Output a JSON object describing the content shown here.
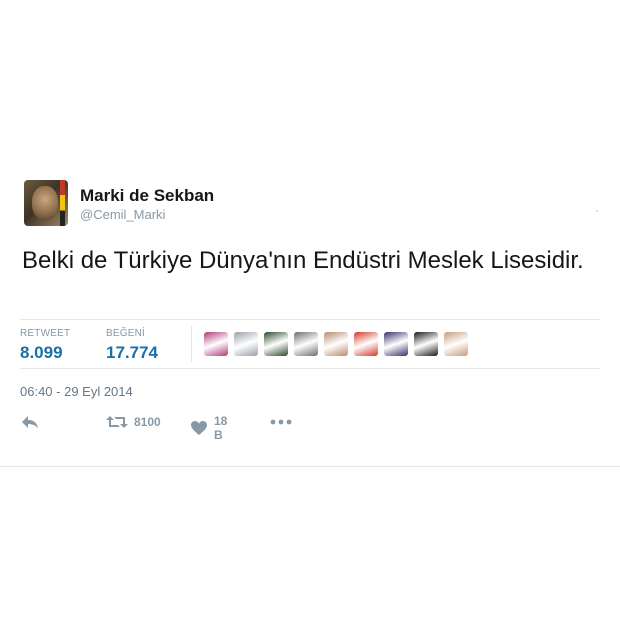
{
  "user": {
    "name": "Marki de Sekban",
    "handle": "@Cemil_Marki"
  },
  "tweet": {
    "text": "Belki de Türkiye Dünya'nın Endüstri Meslek Lisesidir.",
    "timestamp": "06:40 - 29 Eyl 2014"
  },
  "stats": {
    "retweet_label": "RETWEET",
    "retweet_value": "8.099",
    "like_label": "BEĞENİ",
    "like_value": "17.774"
  },
  "likers": [
    {
      "icon": "liker-avatar-1",
      "color": "#b03a7a"
    },
    {
      "icon": "liker-avatar-2",
      "color": "#9aa0a8"
    },
    {
      "icon": "liker-avatar-3",
      "color": "#2e4a2e"
    },
    {
      "icon": "liker-avatar-4",
      "color": "#6d6d6d"
    },
    {
      "icon": "liker-avatar-5",
      "color": "#b88a70"
    },
    {
      "icon": "liker-avatar-6",
      "color": "#d43a2a"
    },
    {
      "icon": "liker-avatar-7",
      "color": "#3a2f6a"
    },
    {
      "icon": "liker-avatar-8",
      "color": "#1a1a1a"
    },
    {
      "icon": "liker-avatar-9",
      "color": "#c89a7a"
    }
  ],
  "actions": {
    "reply_icon": "reply-icon",
    "retweet_icon": "retweet-icon",
    "retweet_count": "8100",
    "like_icon": "heart-icon",
    "like_count": "18 B",
    "more_icon": "more-icon"
  },
  "colors": {
    "accent": "#1b6fa8",
    "muted": "#8899a6",
    "divider": "#e1e8ed"
  }
}
